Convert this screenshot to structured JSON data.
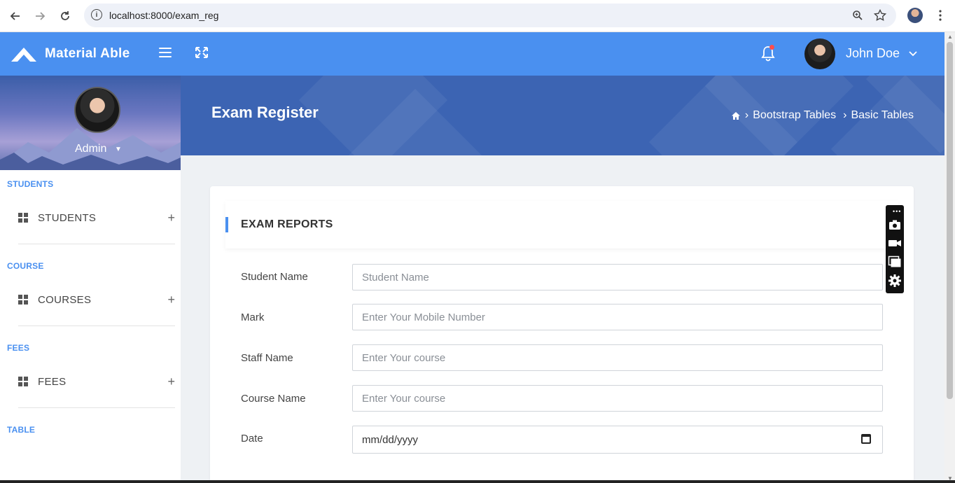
{
  "browser": {
    "url": "localhost:8000/exam_reg",
    "back_icon": "back-arrow-icon",
    "forward_icon": "forward-arrow-icon",
    "reload_icon": "reload-icon"
  },
  "header": {
    "brand": "Material Able",
    "user_name": "John Doe",
    "brand_color": "#4a90f0"
  },
  "sidebar": {
    "profile_name": "Admin",
    "sections": [
      {
        "label": "STUDENTS",
        "item": "STUDENTS"
      },
      {
        "label": "COURSE",
        "item": "COURSES"
      },
      {
        "label": "FEES",
        "item": "FEES"
      },
      {
        "label": "TABLE"
      }
    ]
  },
  "page": {
    "title": "Exam Register",
    "breadcrumb": [
      "Bootstrap Tables",
      "Basic Tables"
    ]
  },
  "card": {
    "title": "EXAM REPORTS",
    "fields": [
      {
        "label": "Student Name",
        "placeholder": "Student Name"
      },
      {
        "label": "Mark",
        "placeholder": "Enter Your Mobile Number"
      },
      {
        "label": "Staff Name",
        "placeholder": "Enter Your course"
      },
      {
        "label": "Course Name",
        "placeholder": "Enter Your course"
      },
      {
        "label": "Date",
        "value": "mm/dd/yyyy"
      }
    ]
  }
}
